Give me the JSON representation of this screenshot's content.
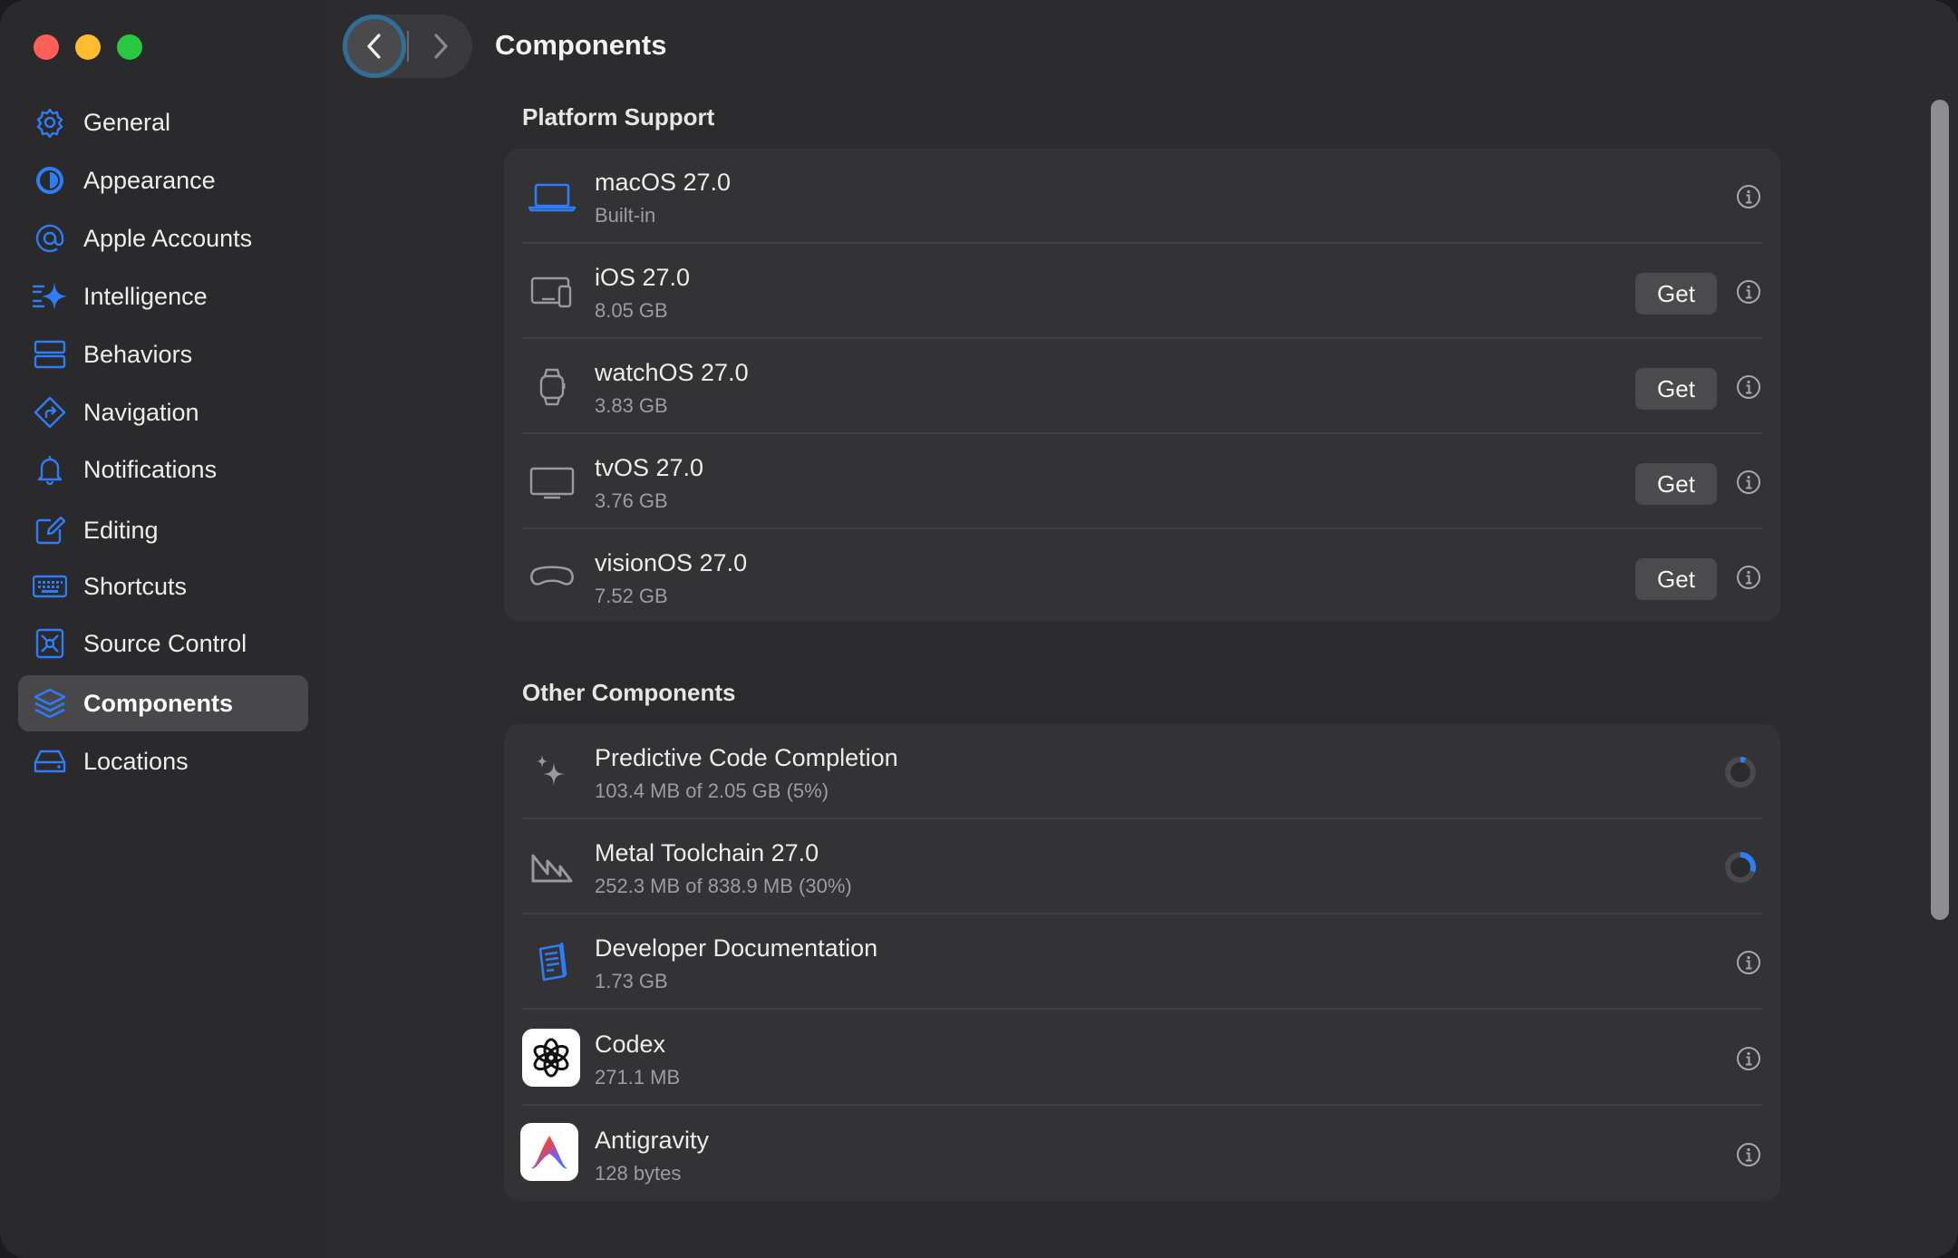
{
  "window": {
    "title": "Components"
  },
  "sidebar": {
    "items": [
      {
        "label": "General",
        "icon": "gear-icon",
        "selected": false
      },
      {
        "label": "Appearance",
        "icon": "appearance-icon",
        "selected": false
      },
      {
        "label": "Apple Accounts",
        "icon": "at-sign-icon",
        "selected": false
      },
      {
        "label": "Intelligence",
        "icon": "sparkle-icon",
        "selected": false
      },
      {
        "label": "Behaviors",
        "icon": "behaviors-icon",
        "selected": false
      },
      {
        "label": "Navigation",
        "icon": "navigation-arrow-icon",
        "selected": false
      },
      {
        "label": "Notifications",
        "icon": "bell-icon",
        "selected": false
      },
      {
        "label": "Editing",
        "icon": "pencil-square-icon",
        "selected": false
      },
      {
        "label": "Shortcuts",
        "icon": "keyboard-icon",
        "selected": false
      },
      {
        "label": "Source Control",
        "icon": "source-control-icon",
        "selected": false
      },
      {
        "label": "Components",
        "icon": "stack-layers-icon",
        "selected": true
      },
      {
        "label": "Locations",
        "icon": "drive-icon",
        "selected": false
      }
    ]
  },
  "toolbar": {
    "title": "Components"
  },
  "platform_support": {
    "title": "Platform Support",
    "rows": [
      {
        "name": "macOS 27.0",
        "detail": "Built-in",
        "icon": "laptop-icon",
        "action": ""
      },
      {
        "name": "iOS 27.0",
        "detail": "8.05 GB",
        "icon": "ios-devices-icon",
        "action": "Get"
      },
      {
        "name": "watchOS 27.0",
        "detail": "3.83 GB",
        "icon": "watch-icon",
        "action": "Get"
      },
      {
        "name": "tvOS 27.0",
        "detail": "3.76 GB",
        "icon": "tv-icon",
        "action": "Get"
      },
      {
        "name": "visionOS 27.0",
        "detail": "7.52 GB",
        "icon": "vision-pro-icon",
        "action": "Get"
      }
    ]
  },
  "other_components": {
    "title": "Other Components",
    "rows": [
      {
        "name": "Predictive Code Completion",
        "detail": "103.4 MB of 2.05 GB (5%)",
        "icon": "sparkles-icon",
        "progress": 0.05
      },
      {
        "name": "Metal Toolchain 27.0",
        "detail": "252.3 MB of 838.9 MB (30%)",
        "icon": "metal-icon",
        "progress": 0.3
      },
      {
        "name": "Developer Documentation",
        "detail": "1.73 GB",
        "icon": "documentation-icon"
      },
      {
        "name": "Codex",
        "detail": "271.1 MB",
        "icon": "codex-app-icon"
      },
      {
        "name": "Antigravity",
        "detail": "128 bytes",
        "icon": "antigravity-app-icon"
      }
    ]
  },
  "colors": {
    "accent": "#2f7df6",
    "close": "#ff5f57",
    "minimize": "#febc2e",
    "maximize": "#28c840"
  }
}
